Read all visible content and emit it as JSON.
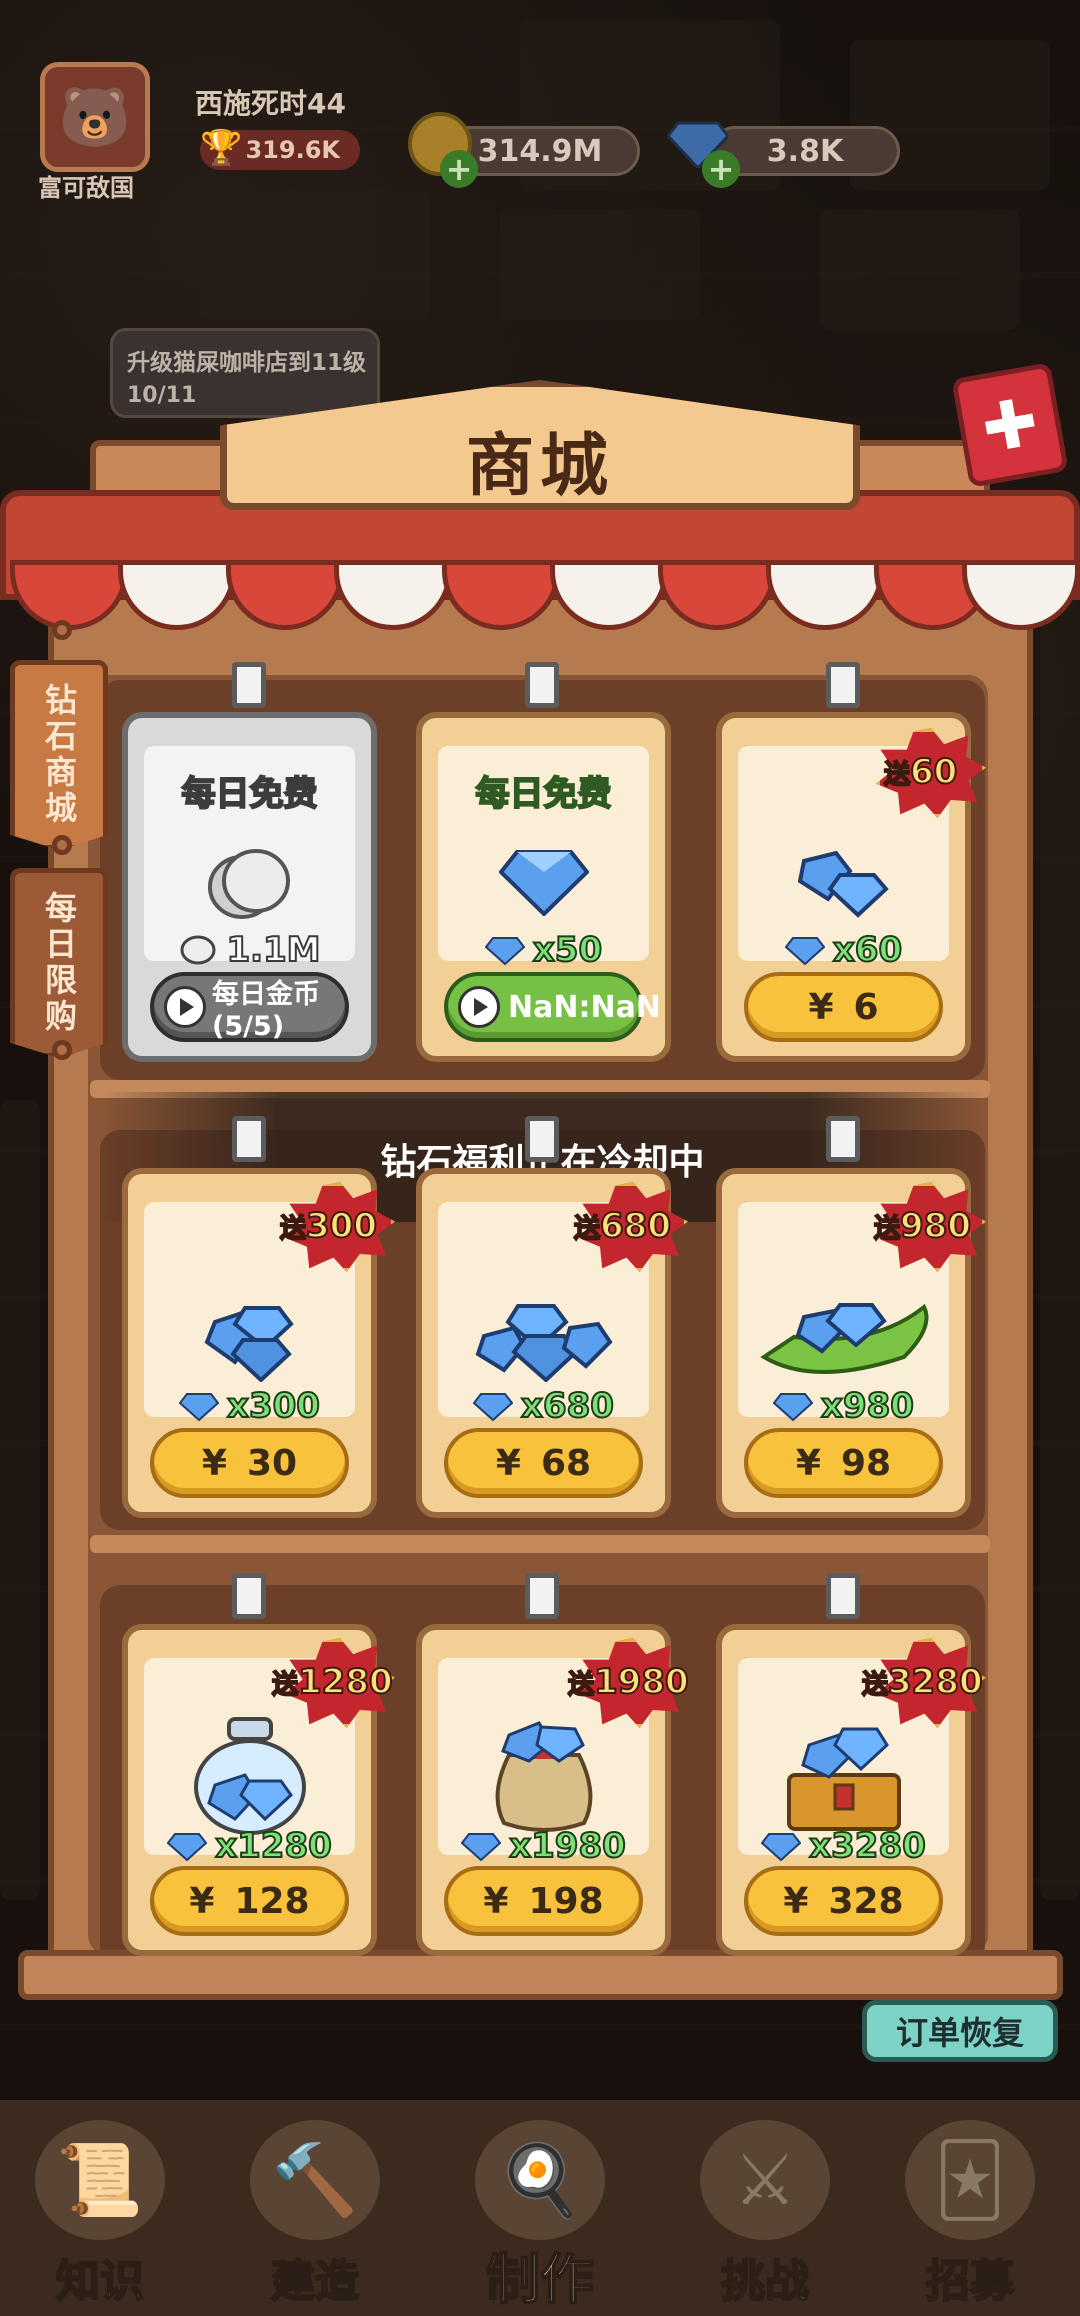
{
  "hud": {
    "player_name": "西施死时44",
    "guild_name": "富可敌国",
    "trophies": "319.6K",
    "coins": "314.9M",
    "gems": "3.8K"
  },
  "quest": {
    "text": "升级猫屎咖啡店到11级",
    "progress": "10/11"
  },
  "shop": {
    "title": "商城",
    "tabs": [
      {
        "label": "钻石商城",
        "active": true
      },
      {
        "label": "每日限购",
        "active": false
      }
    ],
    "cooldown_notice": "钻石福利正在冷却中",
    "restore_label": "订单恢复",
    "rows": [
      [
        {
          "title": "每日免费",
          "qty": "1.1M",
          "button": "每日金币(5/5)",
          "style": "silver",
          "icon": "silver-coin-icon"
        },
        {
          "title": "每日免费",
          "qty": "x50",
          "button": "NaN:NaN",
          "style": "green",
          "icon": "diamond-icon"
        },
        {
          "badge": "60",
          "qty": "x60",
          "price": "6",
          "icon": "diamond-pair-icon"
        }
      ],
      [
        {
          "badge": "300",
          "qty": "x300",
          "price": "30",
          "icon": "diamond-pile-icon"
        },
        {
          "badge": "680",
          "qty": "x680",
          "price": "68",
          "icon": "diamond-heap-icon"
        },
        {
          "badge": "980",
          "qty": "x980",
          "price": "98",
          "icon": "diamond-leaf-icon"
        }
      ],
      [
        {
          "badge": "1280",
          "qty": "x1280",
          "price": "128",
          "icon": "diamond-jar-icon"
        },
        {
          "badge": "1980",
          "qty": "x1980",
          "price": "198",
          "icon": "diamond-sack-icon"
        },
        {
          "badge": "3280",
          "qty": "x3280",
          "price": "328",
          "icon": "treasure-chest-icon"
        }
      ]
    ],
    "badge_prefix": "送",
    "currency": "¥"
  },
  "nav": [
    {
      "label": "知识",
      "icon": "scroll-icon"
    },
    {
      "label": "建造",
      "icon": "hammer-icon"
    },
    {
      "label": "制作",
      "icon": "pot-icon",
      "active": true
    },
    {
      "label": "挑战",
      "icon": "swords-icon"
    },
    {
      "label": "招募",
      "icon": "cards-icon"
    }
  ],
  "colors": {
    "price_button": "#f8c23c",
    "badge_red": "#c4262e",
    "gem_green_text": "#7ee07a",
    "restore_button": "#7dd2c6"
  }
}
